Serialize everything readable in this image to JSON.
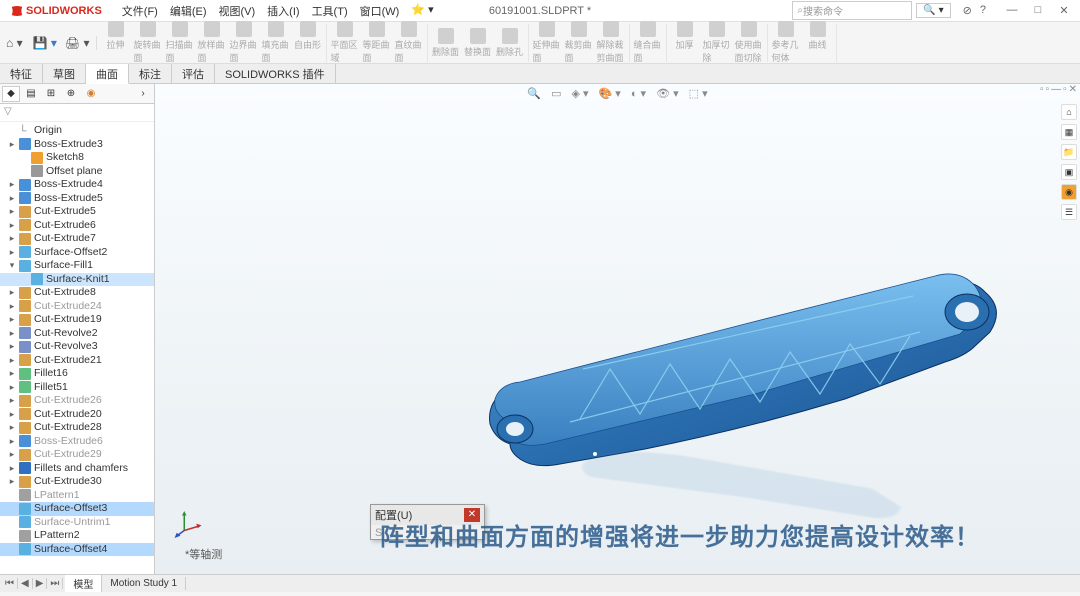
{
  "app_name": "SOLIDWORKS",
  "menus": [
    "文件(F)",
    "编辑(E)",
    "视图(V)",
    "插入(I)",
    "工具(T)",
    "窗口(W)"
  ],
  "doc_title": "60191001.SLDPRT *",
  "search_placeholder": "搜索命令",
  "ribbon": {
    "groups": [
      {
        "labels": [
          "拉伸",
          "旋转曲面",
          "扫描曲面",
          "放样曲面",
          "边界曲面",
          "填充曲面",
          "自由形"
        ]
      },
      {
        "labels": [
          "平面区域",
          "等距曲面",
          "直纹曲面"
        ]
      },
      {
        "labels": [
          "删除面",
          "替换面",
          "删除孔"
        ]
      },
      {
        "labels": [
          "延伸曲面",
          "裁剪曲面",
          "解除裁剪曲面"
        ]
      },
      {
        "labels": [
          "缝合曲面"
        ]
      },
      {
        "labels": [
          "加厚",
          "加厚切除",
          "使用曲面切除"
        ]
      },
      {
        "labels": [
          "参考几何体",
          "曲线"
        ]
      }
    ]
  },
  "tabs": [
    "特征",
    "草图",
    "曲面",
    "标注",
    "评估",
    "SOLIDWORKS 插件"
  ],
  "active_tab": 2,
  "tree": [
    {
      "t": "",
      "lbl": "Origin",
      "ic": "origin"
    },
    {
      "t": "▸",
      "lbl": "Boss-Extrude3",
      "ic": "ext"
    },
    {
      "t": "",
      "lbl": "Sketch8",
      "ic": "sketch",
      "indent": 1
    },
    {
      "t": "",
      "lbl": "Offset plane",
      "ic": "plane",
      "indent": 1
    },
    {
      "t": "▸",
      "lbl": "Boss-Extrude4",
      "ic": "ext"
    },
    {
      "t": "▸",
      "lbl": "Boss-Extrude5",
      "ic": "ext"
    },
    {
      "t": "▸",
      "lbl": "Cut-Extrude5",
      "ic": "cut"
    },
    {
      "t": "▸",
      "lbl": "Cut-Extrude6",
      "ic": "cut"
    },
    {
      "t": "▸",
      "lbl": "Cut-Extrude7",
      "ic": "cut"
    },
    {
      "t": "▸",
      "lbl": "Surface-Offset2",
      "ic": "surf"
    },
    {
      "t": "▾",
      "lbl": "Surface-Fill1",
      "ic": "surf"
    },
    {
      "t": "",
      "lbl": "Surface-Knit1",
      "ic": "surf",
      "indent": 1,
      "sel": true
    },
    {
      "t": "▸",
      "lbl": "Cut-Extrude8",
      "ic": "cut"
    },
    {
      "t": "▸",
      "lbl": "Cut-Extrude24",
      "ic": "cut",
      "grey": true
    },
    {
      "t": "▸",
      "lbl": "Cut-Extrude19",
      "ic": "cut"
    },
    {
      "t": "▸",
      "lbl": "Cut-Revolve2",
      "ic": "rev"
    },
    {
      "t": "▸",
      "lbl": "Cut-Revolve3",
      "ic": "rev"
    },
    {
      "t": "▸",
      "lbl": "Cut-Extrude21",
      "ic": "cut"
    },
    {
      "t": "▸",
      "lbl": "Fillet16",
      "ic": "fil"
    },
    {
      "t": "▸",
      "lbl": "Fillet51",
      "ic": "fil"
    },
    {
      "t": "▸",
      "lbl": "Cut-Extrude26",
      "ic": "cut",
      "grey": true
    },
    {
      "t": "▸",
      "lbl": "Cut-Extrude20",
      "ic": "cut"
    },
    {
      "t": "▸",
      "lbl": "Cut-Extrude28",
      "ic": "cut"
    },
    {
      "t": "▸",
      "lbl": "Boss-Extrude6",
      "ic": "ext",
      "grey": true
    },
    {
      "t": "▸",
      "lbl": "Cut-Extrude29",
      "ic": "cut",
      "grey": true
    },
    {
      "t": "▸",
      "lbl": "Fillets and chamfers",
      "ic": "fold"
    },
    {
      "t": "▸",
      "lbl": "Cut-Extrude30",
      "ic": "cut"
    },
    {
      "t": "",
      "lbl": "LPattern1",
      "ic": "pat",
      "grey": true
    },
    {
      "t": "",
      "lbl": "Surface-Offset3",
      "ic": "surf",
      "sel2": true
    },
    {
      "t": "",
      "lbl": "Surface-Untrim1",
      "ic": "surf",
      "grey": true
    },
    {
      "t": "",
      "lbl": "LPattern2",
      "ic": "pat"
    },
    {
      "t": "",
      "lbl": "Surface-Offset4",
      "ic": "surf",
      "sel2": true
    }
  ],
  "popup": {
    "title": "配置(U)",
    "body": "S"
  },
  "overlay": "阵型和曲面方面的增强将进一步助力您提高设计效率！",
  "status": "*等轴测",
  "bottom_tabs": [
    "模型",
    "Motion Study 1"
  ]
}
